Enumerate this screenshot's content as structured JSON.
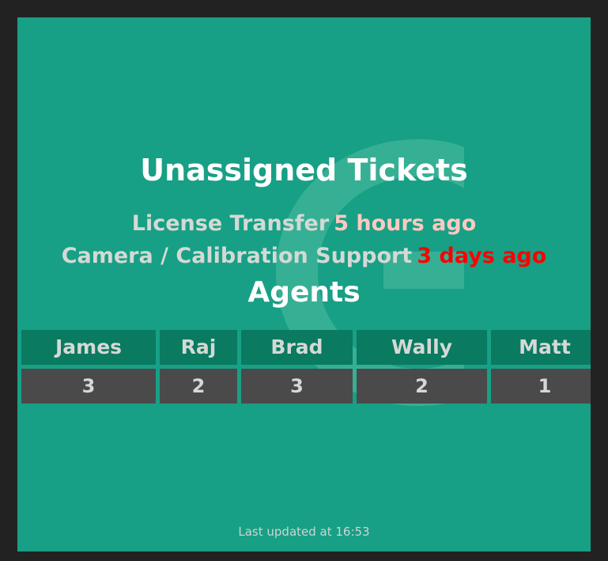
{
  "board": {
    "title": "Unassigned Tickets",
    "agents_heading": "Agents",
    "last_updated": "Last updated at 16:53",
    "background_color": "#17a085",
    "frame_color": "#222222",
    "header_cell_color": "#0a7a61",
    "value_cell_color": "#4a4a4a",
    "warn_color": "#ffc9c1",
    "critical_color": "#ff0000",
    "subject_color": "#d5d9d5"
  },
  "tickets": [
    {
      "subject": "License Transfer",
      "age": "5 hours ago",
      "severity": "warn"
    },
    {
      "subject": "Camera / Calibration Support",
      "age": "3 days ago",
      "severity": "critical"
    }
  ],
  "agents": {
    "names": [
      "James",
      "Raj",
      "Brad",
      "Wally",
      "Matt"
    ],
    "counts": [
      "3",
      "2",
      "3",
      "2",
      "1"
    ]
  }
}
